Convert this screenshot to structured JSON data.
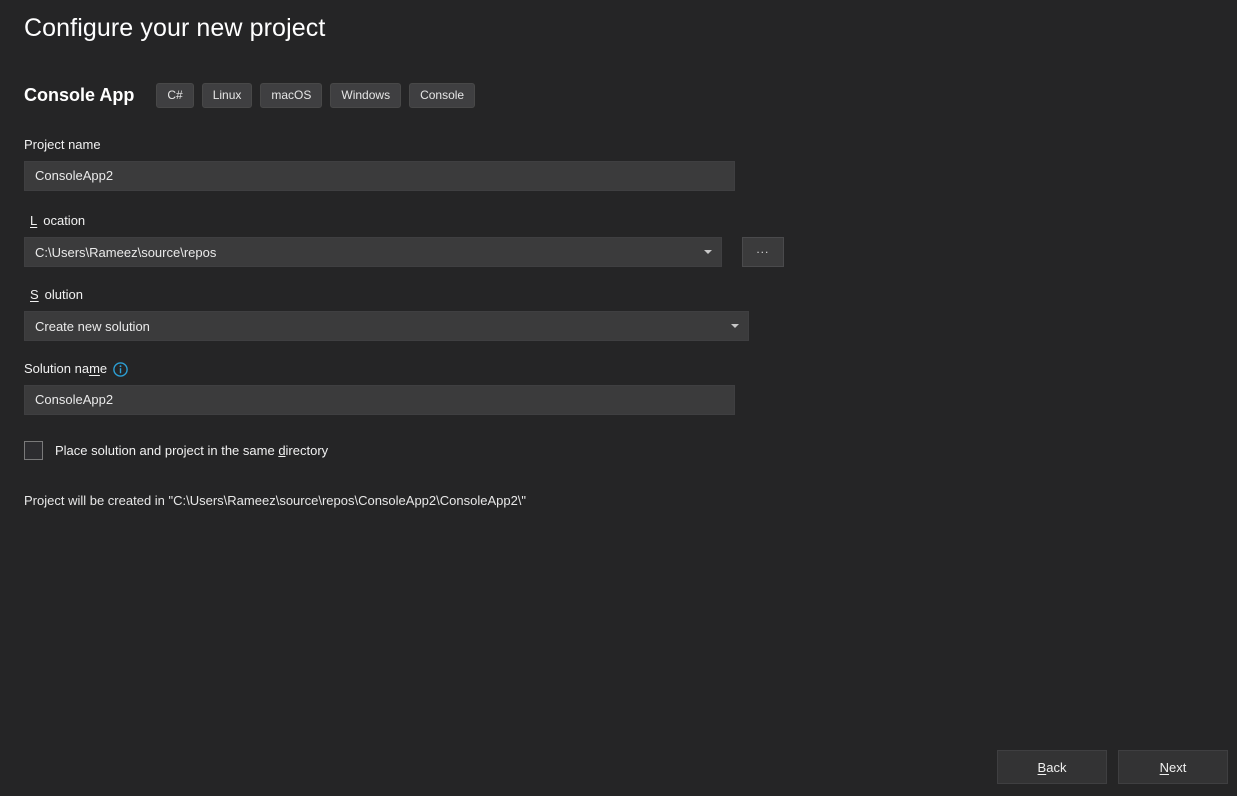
{
  "window": {
    "title": "Configure your new project"
  },
  "template": {
    "name": "Console App",
    "tags": [
      {
        "label": "C#"
      },
      {
        "label": "Linux"
      },
      {
        "label": "macOS"
      },
      {
        "label": "Windows"
      },
      {
        "label": "Console"
      }
    ]
  },
  "form": {
    "project_name": {
      "label": "Project name",
      "label_pre": "Project name",
      "label_accesskey": "",
      "label_post": "",
      "value": "ConsoleApp2"
    },
    "location": {
      "label_pre": "",
      "label_accesskey": "L",
      "label_post": "ocation",
      "value": "C:\\Users\\Rameez\\source\\repos",
      "browse_label": "...",
      "dropdown_icon": "chevron-down-icon"
    },
    "solution": {
      "label_pre": "",
      "label_accesskey": "S",
      "label_post": "olution",
      "value": "Create new solution",
      "dropdown_icon": "chevron-down-icon"
    },
    "solution_name": {
      "label_pre": "Solution na",
      "label_accesskey": "m",
      "label_post": "e",
      "value": "ConsoleApp2",
      "info_icon": "info-circle-icon",
      "info_icon_color": "#2c9fd4"
    },
    "same_directory": {
      "label_pre": "Place solution and project in the same ",
      "label_accesskey": "d",
      "label_post": "irectory",
      "checked": false
    },
    "created_in_text": "Project will be created in \"C:\\Users\\Rameez\\source\\repos\\ConsoleApp2\\ConsoleApp2\\\""
  },
  "footer": {
    "back": {
      "pre": "",
      "accesskey": "B",
      "post": "ack"
    },
    "next": {
      "pre": "",
      "accesskey": "N",
      "post": "ext"
    }
  },
  "colors": {
    "page_background": "#252526",
    "field_background": "#3b3b3c",
    "tag_background": "#3f3f41",
    "button_background": "#333334",
    "text": "#f1f1f1",
    "accent_info": "#2c9fd4"
  }
}
